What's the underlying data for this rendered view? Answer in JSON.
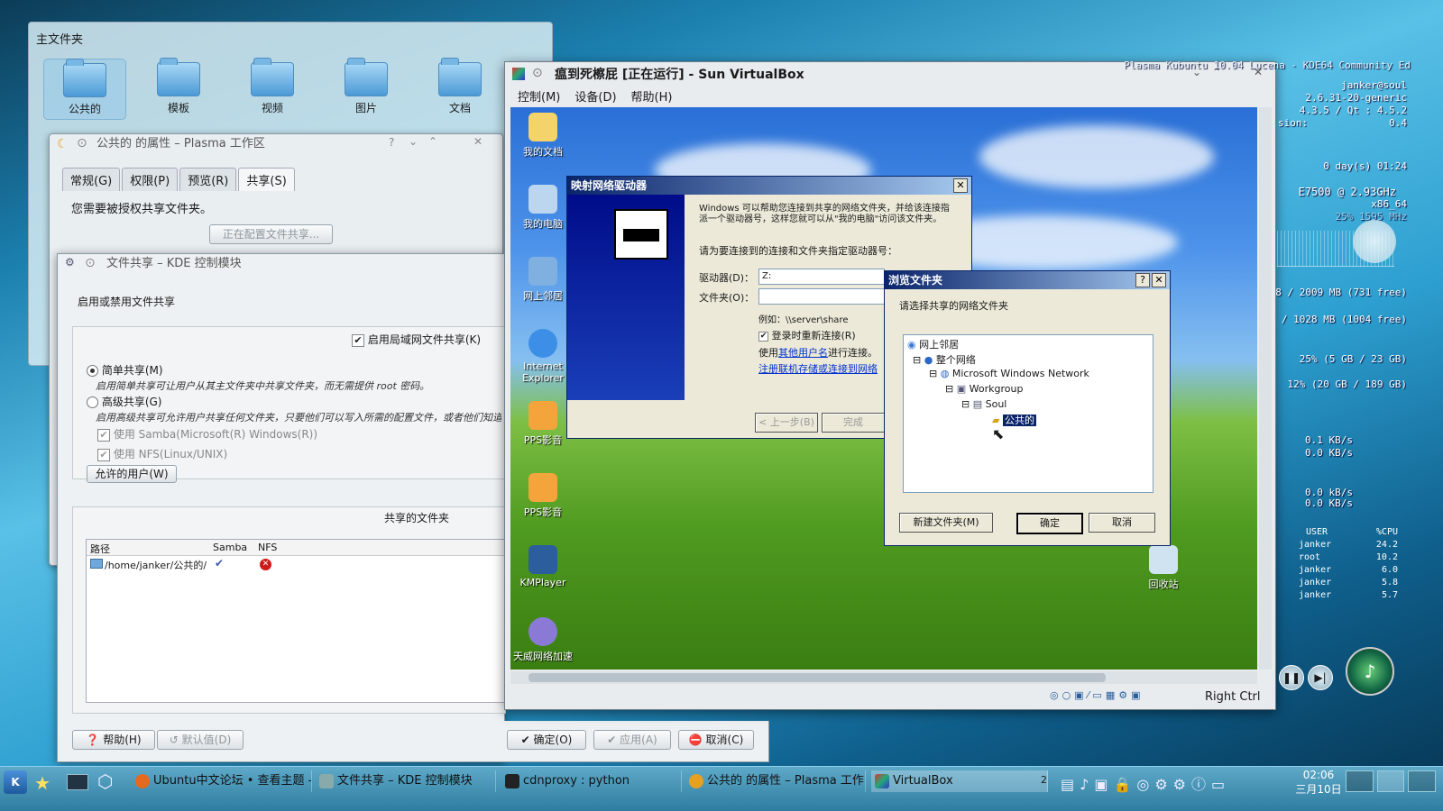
{
  "folder_window": {
    "title": "主文件夹",
    "items": [
      "公共的",
      "模板",
      "视频",
      "图片",
      "文档"
    ]
  },
  "properties_dialog": {
    "title": "公共的 的属性 – Plasma 工作区",
    "tabs": [
      "常规(G)",
      "权限(P)",
      "预览(R)",
      "共享(S)"
    ],
    "message": "您需要被授权共享文件夹。",
    "config_button": "正在配置文件共享..."
  },
  "kcm_window": {
    "title": "文件共享 – KDE 控制模块",
    "heading": "启用或禁用文件共享",
    "enable_lan": "启用局域网文件共享(K)",
    "simple_share": "简单共享(M)",
    "simple_desc": "启用简单共享可让用户从其主文件夹中共享文件夹，而无需提供 root 密码。",
    "advanced_share": "高级共享(G)",
    "advanced_desc": "启用高级共享可允许用户共享任何文件夹，只要他们可以写入所需的配置文件，或者他们知道 ro",
    "use_samba": "使用 Samba(Microsoft(R) Windows(R))",
    "use_nfs": "使用 NFS(Linux/UNIX)",
    "allowed_users": "允许的用户(W)",
    "shared_folders_title": "共享的文件夹",
    "columns": [
      "路径",
      "Samba",
      "NFS"
    ],
    "rows": [
      {
        "path": "/home/janker/公共的/"
      }
    ],
    "help_btn": "帮助(H)",
    "default_btn": "默认值(D)",
    "ok_btn": "确定(O)",
    "apply_btn": "应用(A)",
    "cancel_btn": "取消(C)"
  },
  "virtualbox": {
    "title": "瘟到死檫屁 [正在运行] - Sun VirtualBox",
    "menu": [
      "控制(M)",
      "设备(D)",
      "帮助(H)"
    ],
    "status_text": "Right Ctrl",
    "desktop_icons": [
      "我的文档",
      "我的电脑",
      "网上邻居",
      "Internet Explorer",
      "PPS影音",
      "PPS影音",
      "KMPlayer",
      "天威网络加速",
      "回收站"
    ]
  },
  "map_drive": {
    "title": "映射网络驱动器",
    "description": "Windows 可以帮助您连接到共享的网络文件夹，并给该连接指派一个驱动器号，这样您就可以从\"我的电脑\"访问该文件夹。",
    "prompt": "请为要连接到的连接和文件夹指定驱动器号：",
    "drive_label": "驱动器(D)：",
    "drive_value": "Z:",
    "folder_label": "文件夹(O)：",
    "example": "例如：\\\\server\\share",
    "reconnect": "登录时重新连接(R)",
    "use_other_prefix": "使用",
    "use_other_link": "其他用户名",
    "use_other_suffix": "进行连接。",
    "register_link": "注册联机存储或连接到网络",
    "back_btn": "< 上一步(B)",
    "finish_btn": "完成"
  },
  "browse_folder": {
    "title": "浏览文件夹",
    "prompt": "请选择共享的网络文件夹",
    "tree": [
      "网上邻居",
      "整个网络",
      "Microsoft Windows Network",
      "Workgroup",
      "Soul",
      "公共的"
    ],
    "new_folder_btn": "新建文件夹(M)",
    "ok_btn": "确定",
    "cancel_btn": "取消"
  },
  "conky": {
    "top_line": "Plasma Kubuntu 10.04 Lucena - KDE64 Community Ed",
    "user": "janker@soul",
    "kernel": "2.6.31-20-generic",
    "qt": "4.3.5 / Qt : 4.5.2",
    "version_label": "sion:",
    "version_value": "0.4",
    "uptime": "0 day(s)  01:24",
    "cpu": "E7500  @ 2.93GHz",
    "arch": "x86_64",
    "cpu_line1": "25%  1595 MHz",
    "ram": "8 / 2009 MB (731 free)",
    "swap": "/ 1028 MB (1004 free)",
    "disk1": "25% (5 GB / 23 GB)",
    "disk2": "12% (20 GB / 189 GB)",
    "net_up1": "0.1 KB/s",
    "net_down1": "0.0 KB/s",
    "net_up2": "0.0 kB/s",
    "net_down2": "0.0 KB/s",
    "proc_header": [
      "USER",
      "%CPU"
    ],
    "procs": [
      [
        "janker",
        "24.2"
      ],
      [
        "root",
        "10.2"
      ],
      [
        "janker",
        "6.0"
      ],
      [
        "janker",
        "5.8"
      ],
      [
        "janker",
        "5.7"
      ]
    ]
  },
  "taskbar": {
    "tasks": [
      "Ubuntu中文论坛 • 查看主题 -",
      "文件共享 – KDE 控制模块",
      "cdnproxy : python",
      "公共的 的属性 – Plasma 工作区",
      "VirtualBox"
    ],
    "pager_num": "2",
    "time": "02:06",
    "date": "三月10日"
  },
  "colors": {
    "xp_title": "#0a246a",
    "kde_blue": "#2e7ca0"
  }
}
